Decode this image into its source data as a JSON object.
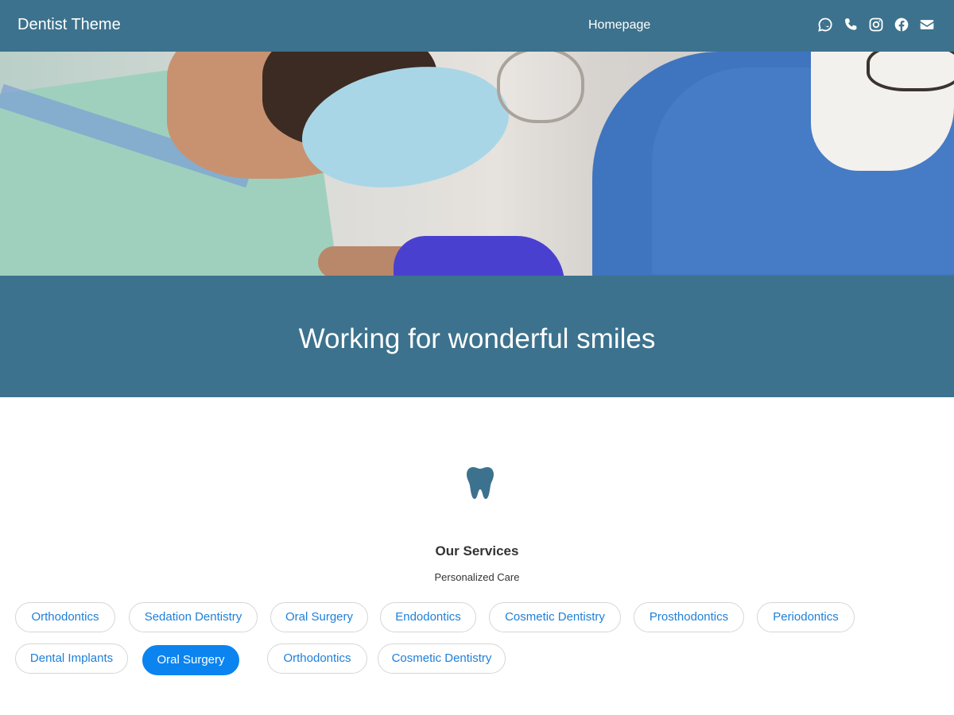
{
  "header": {
    "brand": "Dentist Theme",
    "nav": {
      "homepage": "Homepage"
    },
    "social_icons": [
      "whatsapp-icon",
      "phone-icon",
      "instagram-icon",
      "facebook-icon",
      "mail-icon"
    ]
  },
  "banner": {
    "title": "Working for wonderful smiles"
  },
  "services": {
    "icon": "tooth-icon",
    "title": "Our Services",
    "subtitle": "Personalized Care",
    "items": [
      {
        "label": "Orthodontics",
        "active": false
      },
      {
        "label": "Sedation Dentistry",
        "active": false
      },
      {
        "label": "Oral Surgery",
        "active": false
      },
      {
        "label": "Endodontics",
        "active": false
      },
      {
        "label": "Cosmetic Dentistry",
        "active": false
      },
      {
        "label": "Prosthodontics",
        "active": false
      },
      {
        "label": "Periodontics",
        "active": false
      },
      {
        "label": "Dental Implants",
        "active": false
      },
      {
        "label": "Oral Surgery",
        "active": true
      },
      {
        "label": "Orthodontics",
        "active": false
      },
      {
        "label": "Cosmetic Dentistry",
        "active": false
      }
    ]
  },
  "colors": {
    "primary": "#3c728d",
    "accent": "#0b84f0",
    "link": "#1f7fd8"
  }
}
